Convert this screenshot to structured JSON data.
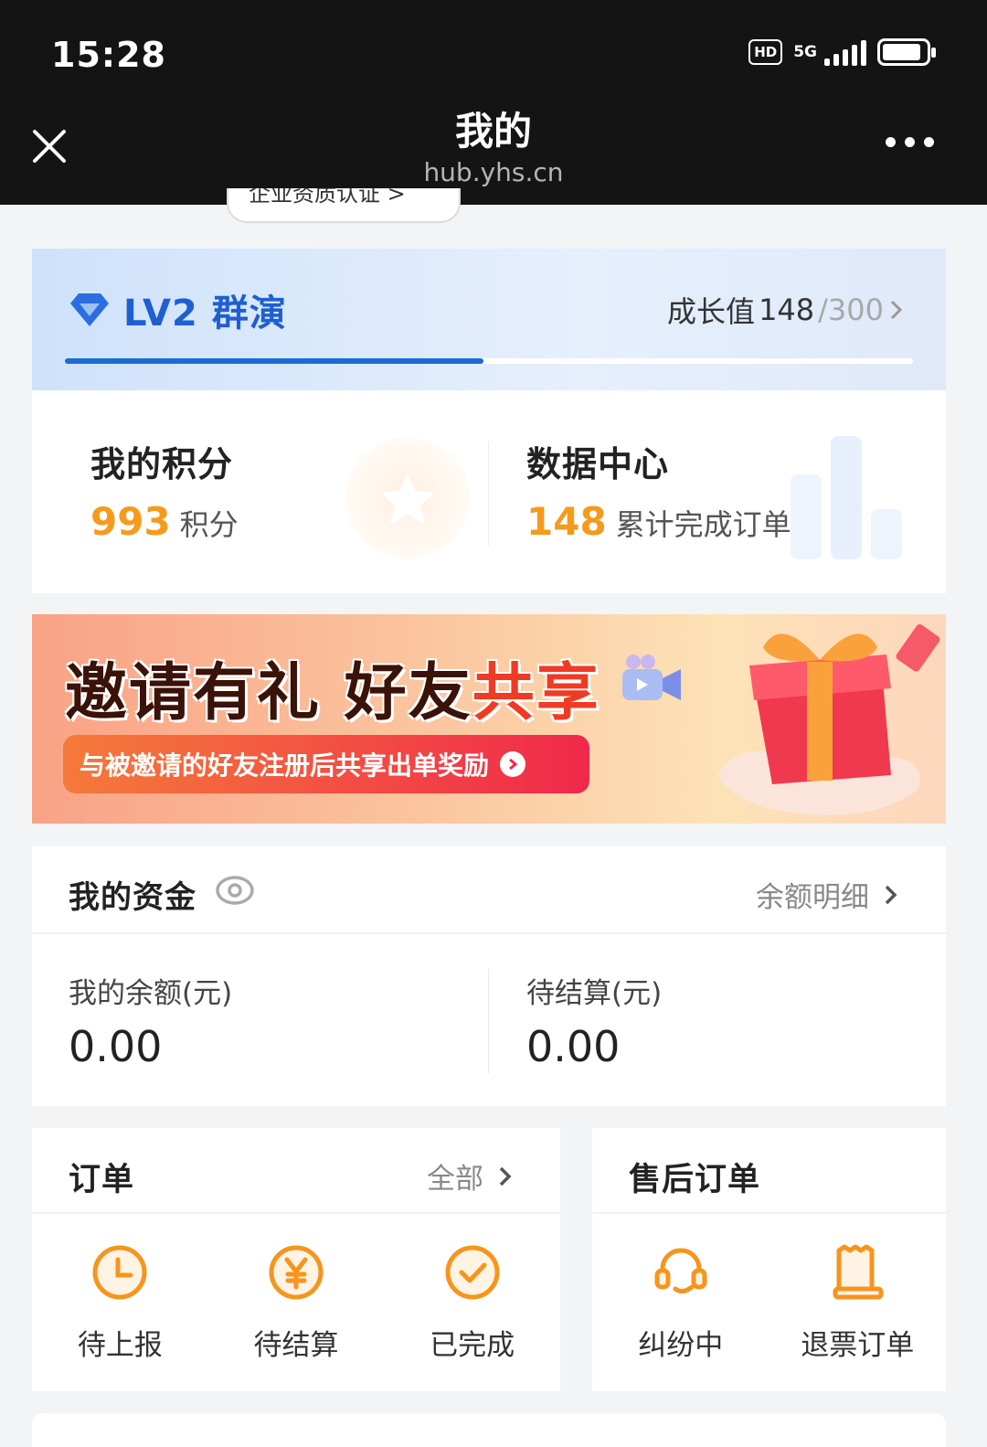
{
  "status_bar": {
    "time": "15:28",
    "hd": "HD",
    "network": "5G"
  },
  "nav": {
    "title": "我的",
    "subtitle": "hub.yhs.cn"
  },
  "cert_pill": {
    "label": "企业资质认证 >"
  },
  "level": {
    "badge": "LV2 群演",
    "growth_label": "成长值",
    "growth_current": "148",
    "growth_max": "/300",
    "progress_fraction": 0.493,
    "accent": "#1a6bd8"
  },
  "stats": {
    "points": {
      "title": "我的积分",
      "value": "993",
      "unit": "积分"
    },
    "data": {
      "title": "数据中心",
      "value": "148",
      "unit": "累计完成订单"
    }
  },
  "banner": {
    "title_part1": "邀请有礼 好友",
    "title_part2": "共享",
    "cta": "与被邀请的好友注册后共享出单奖励"
  },
  "funds": {
    "title": "我的资金",
    "link": "余额明细",
    "balance_label": "我的余额(元)",
    "balance_value": "0.00",
    "pending_label": "待结算(元)",
    "pending_value": "0.00"
  },
  "orders": {
    "title": "订单",
    "link": "全部",
    "items": [
      {
        "label": "待上报",
        "icon": "clock-icon"
      },
      {
        "label": "待结算",
        "icon": "yen-icon"
      },
      {
        "label": "已完成",
        "icon": "check-icon"
      }
    ]
  },
  "after_sales": {
    "title": "售后订单",
    "items": [
      {
        "label": "纠纷中",
        "icon": "headset-icon"
      },
      {
        "label": "退票订单",
        "icon": "receipt-icon"
      }
    ]
  },
  "colors": {
    "orange": "#f59a1b",
    "blue": "#1a6bd8",
    "dark_bar": "#141414"
  }
}
